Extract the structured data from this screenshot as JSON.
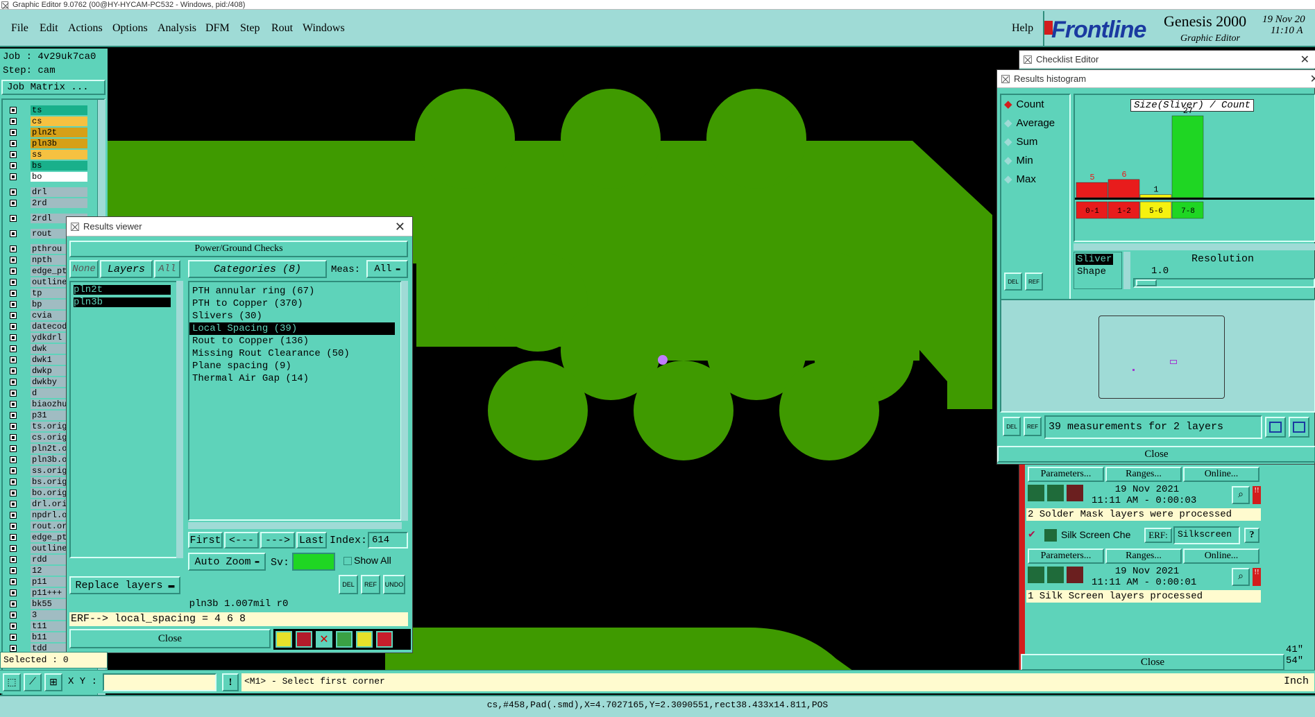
{
  "window": {
    "title": "Graphic Editor 9.0762 (00@HY-HYCAM-PC532 - Windows, pid:/408)"
  },
  "menu": {
    "items": [
      "File",
      "Edit",
      "Actions",
      "Options",
      "Analysis",
      "DFM",
      "Step",
      "Rout",
      "Windows"
    ],
    "help": "Help"
  },
  "brand": {
    "logo": "Frontline",
    "product": "Genesis 2000",
    "subtitle": "Graphic Editor",
    "date": "19 Nov 20",
    "time": "11:10 A"
  },
  "job": {
    "job": "Job : 4v29uk7ca0",
    "step": "Step: cam",
    "matrix": "Job Matrix ..."
  },
  "layers": [
    {
      "name": "ts",
      "color": "#19b08b"
    },
    {
      "name": "cs",
      "color": "#f6c141"
    },
    {
      "name": "pln2t",
      "color": "#d6a017"
    },
    {
      "name": "pln3b",
      "color": "#d6a017"
    },
    {
      "name": "ss",
      "color": "#f6c141"
    },
    {
      "name": "bs",
      "color": "#19b08b"
    },
    {
      "name": "bo",
      "color": "#ffffff"
    },
    {
      "name": "drl",
      "color": "#a0bcc2"
    },
    {
      "name": "2rd",
      "color": "#a0bcc2"
    },
    {
      "name": "2rdl",
      "color": "#a0bcc2"
    },
    {
      "name": "rout",
      "color": "#a0bcc2"
    },
    {
      "name": "pthrou",
      "color": "#a0bcc2"
    },
    {
      "name": "npth",
      "color": "#a0bcc2"
    },
    {
      "name": "edge_pth",
      "color": "#a0bcc2"
    },
    {
      "name": "outline",
      "color": "#a0bcc2"
    },
    {
      "name": "tp",
      "color": "#a0bcc2"
    },
    {
      "name": "bp",
      "color": "#a0bcc2"
    },
    {
      "name": "cvia",
      "color": "#a0bcc2"
    },
    {
      "name": "datecode",
      "color": "#a0bcc2"
    },
    {
      "name": "ydkdrl",
      "color": "#a0bcc2"
    },
    {
      "name": "dwk",
      "color": "#a0bcc2"
    },
    {
      "name": "dwk1",
      "color": "#a0bcc2"
    },
    {
      "name": "dwkp",
      "color": "#a0bcc2"
    },
    {
      "name": "dwkby",
      "color": "#a0bcc2"
    },
    {
      "name": "d",
      "color": "#a0bcc2"
    },
    {
      "name": "biaozhu",
      "color": "#a0bcc2"
    },
    {
      "name": "p31",
      "color": "#a0bcc2"
    },
    {
      "name": "ts.orig",
      "color": "#a0bcc2"
    },
    {
      "name": "cs.orig",
      "color": "#a0bcc2"
    },
    {
      "name": "pln2t.or",
      "color": "#a0bcc2"
    },
    {
      "name": "pln3b.or",
      "color": "#a0bcc2"
    },
    {
      "name": "ss.orig",
      "color": "#a0bcc2"
    },
    {
      "name": "bs.orig",
      "color": "#a0bcc2"
    },
    {
      "name": "bo.orig",
      "color": "#a0bcc2"
    },
    {
      "name": "drl.orig",
      "color": "#a0bcc2"
    },
    {
      "name": "npdrl.or",
      "color": "#a0bcc2"
    },
    {
      "name": "rout.ori",
      "color": "#a0bcc2"
    },
    {
      "name": "edge_pth",
      "color": "#a0bcc2"
    },
    {
      "name": "outline.",
      "color": "#a0bcc2"
    },
    {
      "name": "rdd",
      "color": "#a0bcc2"
    },
    {
      "name": "12",
      "color": "#a0bcc2"
    },
    {
      "name": "p11",
      "color": "#a0bcc2"
    },
    {
      "name": "p11+++",
      "color": "#a0bcc2"
    },
    {
      "name": "bk55",
      "color": "#a0bcc2"
    },
    {
      "name": "3",
      "color": "#a0bcc2"
    },
    {
      "name": "t11",
      "color": "#a0bcc2"
    },
    {
      "name": "b11",
      "color": "#a0bcc2"
    },
    {
      "name": "tdd",
      "color": "#a0bcc2"
    }
  ],
  "selected": "Selected : 0",
  "results_viewer": {
    "title": "Results viewer",
    "section": "Power/Ground Checks",
    "none": "None",
    "layers_label": "Layers",
    "all": "All",
    "layer_list": [
      "pln2t",
      "pln3b"
    ],
    "categories_label": "Categories (8)",
    "meas_label": "Meas:",
    "meas_value": "All",
    "categories": [
      "PTH annular ring (67)",
      "PTH to Copper (370)",
      "Slivers (30)",
      "Local Spacing (39)",
      "Rout to Copper (136)",
      "Missing Rout Clearance (50)",
      "Plane spacing (9)",
      "Thermal Air Gap (14)"
    ],
    "selected_category": "Local Spacing (39)",
    "first": "First",
    "prev": "<---",
    "next": "--->",
    "last": "Last",
    "index_label": "Index:",
    "index_value": "614",
    "auto_zoom": "Auto Zoom",
    "sv": "Sv:",
    "show_all": "Show All",
    "replace_layers": "Replace layers",
    "info": "pln3b 1.007mil  r0",
    "erf": "ERF--> local_spacing = 4 6 8",
    "close": "Close"
  },
  "checklist": {
    "title": "Checklist Editor",
    "params": "Parameters...",
    "ranges": "Ranges...",
    "online": "Online...",
    "run1": {
      "date": "19 Nov 2021",
      "time": "11:11 AM - 0:00:03",
      "msg": "2 Solder Mask layers were processed"
    },
    "silk": {
      "name": "Silk Screen Che",
      "erf": "ERF:",
      "erf_value": "Silkscreen",
      "q": "?"
    },
    "run2": {
      "date": "19 Nov 2021",
      "time": "11:11 AM - 0:00:01",
      "msg": "1 Silk Screen layers processed"
    },
    "close": "Close"
  },
  "histogram": {
    "title": "Results histogram",
    "modes": [
      "Count",
      "Average",
      "Sum",
      "Min",
      "Max"
    ],
    "chart_title": "Size(Sliver) / Count",
    "resolution_label": "Resolution",
    "resolution": "1.0",
    "shape_list": [
      "Sliver",
      "Shape"
    ],
    "summary": "39 measurements for 2 layers",
    "close": "Close"
  },
  "chart_data": {
    "type": "bar",
    "title": "Size(Sliver) / Count",
    "categories": [
      "0-1",
      "1-2",
      "5-6",
      "7-8"
    ],
    "values": [
      5,
      6,
      1,
      27
    ],
    "colors": [
      "#e81c1c",
      "#e81c1c",
      "#f5f10f",
      "#1fd623"
    ],
    "label_colors": [
      "#e81c1c",
      "#e81c1c",
      "#000000",
      "#000000"
    ]
  },
  "bottom": {
    "xy_label": "X Y :",
    "prompt": "<M1> - Select first corner",
    "units": "Inch",
    "coords": [
      "41\"",
      "54\""
    ],
    "status": "cs,#458,Pad(.smd),X=4.7027165,Y=2.3090551,rect38.433x14.811,POS"
  }
}
